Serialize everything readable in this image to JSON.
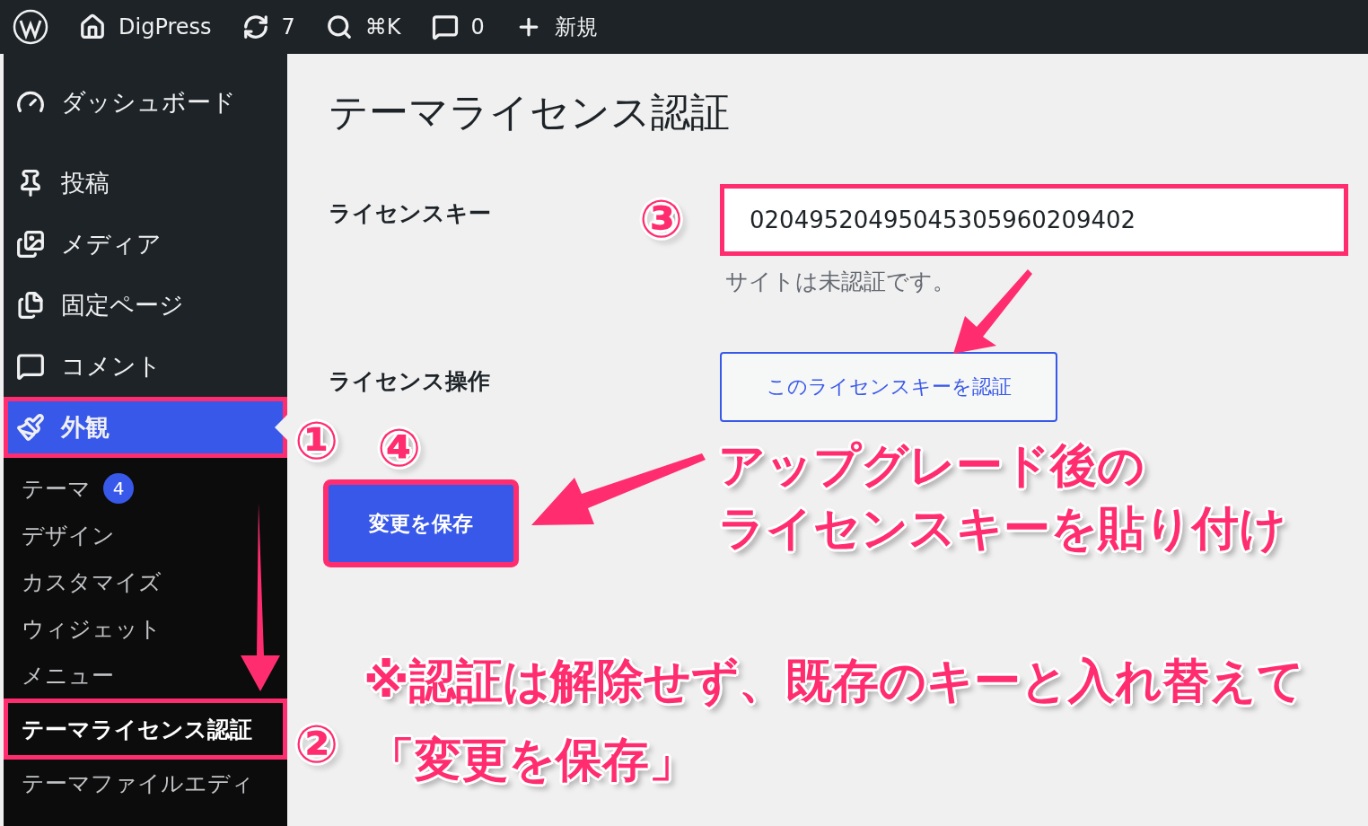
{
  "admin_bar": {
    "items": [
      {
        "kind": "logo"
      },
      {
        "kind": "home",
        "label": "DigPress"
      },
      {
        "kind": "updates",
        "label": "7"
      },
      {
        "kind": "search",
        "label": "⌘K"
      },
      {
        "kind": "comments",
        "label": "0"
      },
      {
        "kind": "new",
        "label": "新規"
      }
    ]
  },
  "sidebar": {
    "items": [
      {
        "kind": "dashboard",
        "label": "ダッシュボード",
        "selected": false,
        "highlighted": false
      },
      {
        "kind": "posts",
        "label": "投稿",
        "selected": false,
        "highlighted": false
      },
      {
        "kind": "media",
        "label": "メディア",
        "selected": false,
        "highlighted": false
      },
      {
        "kind": "pages",
        "label": "固定ページ",
        "selected": false,
        "highlighted": false
      },
      {
        "kind": "comments",
        "label": "コメント",
        "selected": false,
        "highlighted": false
      },
      {
        "kind": "appearance",
        "label": "外観",
        "selected": true,
        "highlighted": true,
        "children": [
          {
            "label": "テーマ",
            "badge": "4",
            "selected": false,
            "highlighted": false
          },
          {
            "label": "デザイン",
            "selected": false,
            "highlighted": false
          },
          {
            "label": "カスタマイズ",
            "selected": false,
            "highlighted": false
          },
          {
            "label": "ウィジェット",
            "selected": false,
            "highlighted": false
          },
          {
            "label": "メニュー",
            "selected": false,
            "highlighted": false
          },
          {
            "label": "テーマライセンス認証",
            "selected": true,
            "highlighted": true
          },
          {
            "label": "テーマファイルエディ",
            "selected": false,
            "highlighted": false
          }
        ]
      }
    ]
  },
  "page": {
    "title": "テーマライセンス認証",
    "license_key": {
      "label": "ライセンスキー",
      "value": "02049520495045305960209402",
      "note": "サイトは未認証です。",
      "highlighted": true
    },
    "license_action": {
      "label": "ライセンス操作",
      "button": "このライセンスキーを認証"
    },
    "save_button": {
      "label": "変更を保存",
      "highlighted": true
    }
  },
  "annotations": {
    "markers": [
      "①",
      "②",
      "③",
      "④"
    ],
    "notes": [
      {
        "lines": [
          "アップグレード後の",
          "ライセンスキーを貼り付け"
        ]
      },
      {
        "lines": [
          "※認証は解除せず、既存のキーと入れ替えて",
          "「変更を保存」"
        ]
      }
    ]
  }
}
